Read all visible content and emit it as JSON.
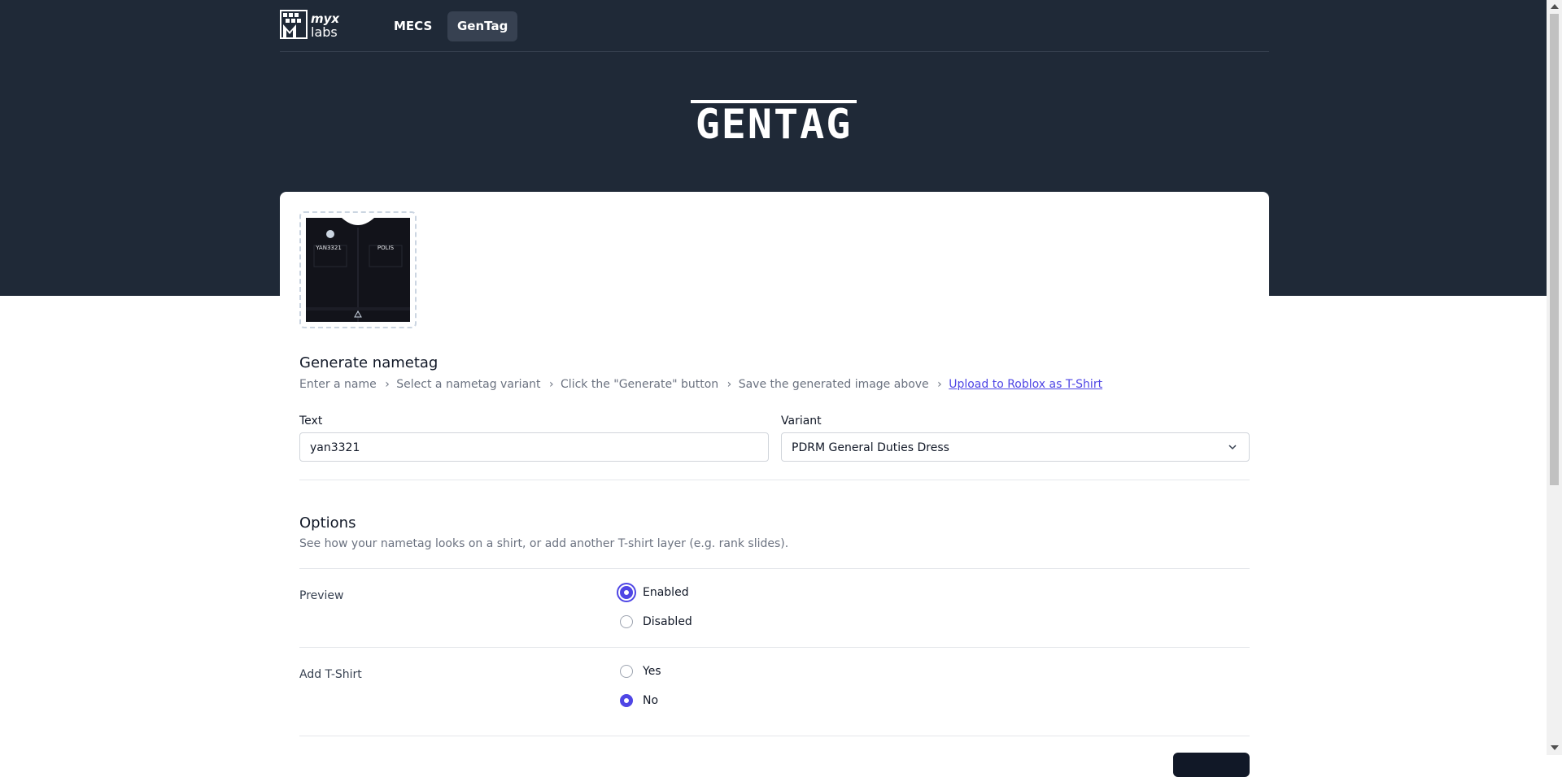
{
  "nav": {
    "brand_top": "myx",
    "brand_bottom": "labs",
    "items": [
      {
        "label": "MECS",
        "active": false
      },
      {
        "label": "GenTag",
        "active": true
      }
    ]
  },
  "hero": {
    "title": "GENTAG"
  },
  "preview": {
    "left_tag": "YAN3321",
    "right_tag": "POLIS"
  },
  "generate": {
    "title": "Generate nametag",
    "steps": [
      "Enter a name",
      "Select a nametag variant",
      "Click the \"Generate\" button",
      "Save the generated image above"
    ],
    "link": "Upload to Roblox as T-Shirt",
    "separator": "›"
  },
  "form": {
    "text_label": "Text",
    "text_value": "yan3321",
    "variant_label": "Variant",
    "variant_value": "PDRM General Duties Dress"
  },
  "options": {
    "title": "Options",
    "description": "See how your nametag looks on a shirt, or add another T-shirt layer (e.g. rank slides).",
    "preview": {
      "label": "Preview",
      "choices": [
        {
          "label": "Enabled",
          "checked": true
        },
        {
          "label": "Disabled",
          "checked": false
        }
      ]
    },
    "add_tshirt": {
      "label": "Add T-Shirt",
      "choices": [
        {
          "label": "Yes",
          "checked": false
        },
        {
          "label": "No",
          "checked": true
        }
      ]
    }
  },
  "colors": {
    "hero_bg": "#1f2937",
    "accent": "#4f46e5",
    "link": "#4f46e5"
  }
}
